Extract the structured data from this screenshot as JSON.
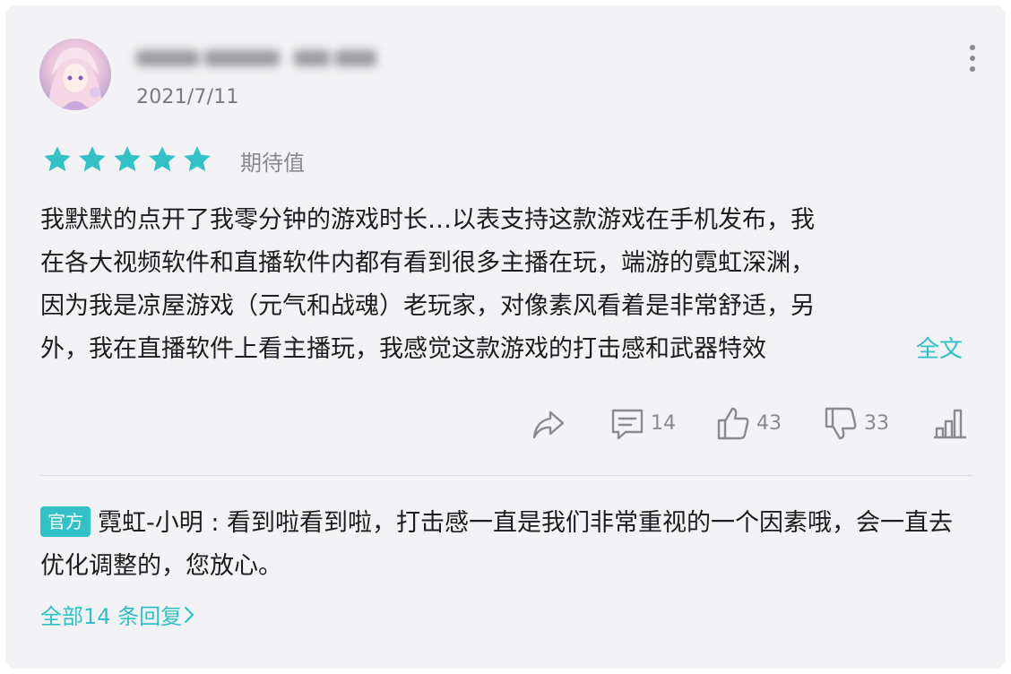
{
  "review": {
    "date": "2021/7/11",
    "rating": 5,
    "rating_label": "期待值",
    "text_lines": [
      "我默默的点开了我零分钟的游戏时长…以表支持这款游戏在手机发布，我",
      "在各大视频软件和直播软件内都有看到很多主播在玩，端游的霓虹深渊，",
      "因为我是凉屋游戏（元气和战魂）老玩家，对像素风看着是非常舒适，另",
      "外，我在直播软件上看主播玩，我感觉这款游戏的打击感和武器特效"
    ],
    "full_text_link": "全文"
  },
  "actions": {
    "comments_count": "14",
    "likes_count": "43",
    "dislikes_count": "33"
  },
  "official_reply": {
    "badge": "官方",
    "author": "霓虹-小明",
    "separator": " : ",
    "text": "看到啦看到啦，打击感一直是我们非常重视的一个因素哦，会一直去优化调整的，您放心。"
  },
  "all_replies_link": "全部14 条回复",
  "colors": {
    "accent": "#2ec2c6",
    "star": "#30c2c6",
    "card_bg": "#f3f3f5"
  },
  "icons": [
    "share-icon",
    "comment-icon",
    "thumbs-up-icon",
    "thumbs-down-icon",
    "stats-icon",
    "more-vertical-icon",
    "star-icon",
    "chevron-right-icon"
  ]
}
